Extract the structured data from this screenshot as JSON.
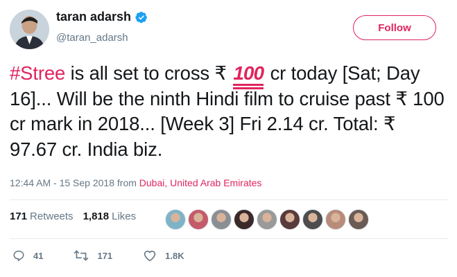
{
  "author": {
    "display_name": "taran adarsh",
    "handle": "@taran_adarsh",
    "verified": true
  },
  "follow_button": {
    "label": "Follow"
  },
  "tweet": {
    "hashtag": "#Stree",
    "text_1": " is all set to cross ₹ ",
    "emoji_text": "100",
    "emoji_name": "hundred-points-emoji",
    "text_2": " cr today [Sat; Day 16]... Will be the ninth Hindi film to cruise past ₹ 100 cr mark in 2018... [Week 3] Fri 2.14 cr. Total: ₹ 97.67 cr. India biz."
  },
  "meta": {
    "timestamp": "12:44 AM - 15 Sep 2018",
    "from_label": " from ",
    "location": "Dubai, United Arab Emirates"
  },
  "stats": {
    "retweets_count": "171",
    "retweets_label": "Retweets",
    "likes_count": "1,818",
    "likes_label": "Likes"
  },
  "liked_by_avatars": [
    {
      "name": "avatar-1",
      "color": "#7fb3c8"
    },
    {
      "name": "avatar-2",
      "color": "#c45a6a"
    },
    {
      "name": "avatar-3",
      "color": "#8a8f94"
    },
    {
      "name": "avatar-4",
      "color": "#3b2a2a"
    },
    {
      "name": "avatar-5",
      "color": "#9a9a9a"
    },
    {
      "name": "avatar-6",
      "color": "#5a3b3b"
    },
    {
      "name": "avatar-7",
      "color": "#4d4d4d"
    },
    {
      "name": "avatar-8",
      "color": "#b88c7a"
    },
    {
      "name": "avatar-9",
      "color": "#6b5b55"
    }
  ],
  "actions": {
    "reply_count": "41",
    "retweet_count": "171",
    "like_count": "1.8K"
  },
  "colors": {
    "accent": "#e0245e",
    "muted": "#657786",
    "verified_blue": "#1da1f2"
  }
}
